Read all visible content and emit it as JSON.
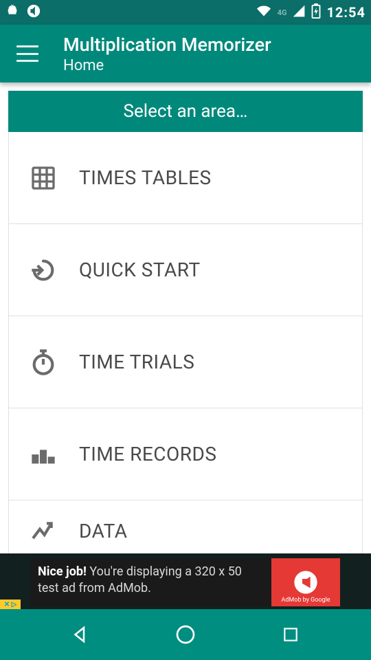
{
  "status": {
    "time": "12:54",
    "network_label": "4G"
  },
  "appbar": {
    "title": "Multiplication Memorizer",
    "subtitle": "Home"
  },
  "select_header": "Select an area…",
  "menu": [
    {
      "label": "TIMES TABLES",
      "icon": "grid-icon"
    },
    {
      "label": "QUICK START",
      "icon": "power-arrow-icon"
    },
    {
      "label": "TIME TRIALS",
      "icon": "stopwatch-icon"
    },
    {
      "label": "TIME RECORDS",
      "icon": "podium-icon"
    },
    {
      "label": "DATA",
      "icon": "chart-line-icon"
    }
  ],
  "ad": {
    "bold": "Nice job!",
    "text": " You're displaying a 320 x 50 test ad from AdMob.",
    "brand": "AdMob by Google"
  }
}
